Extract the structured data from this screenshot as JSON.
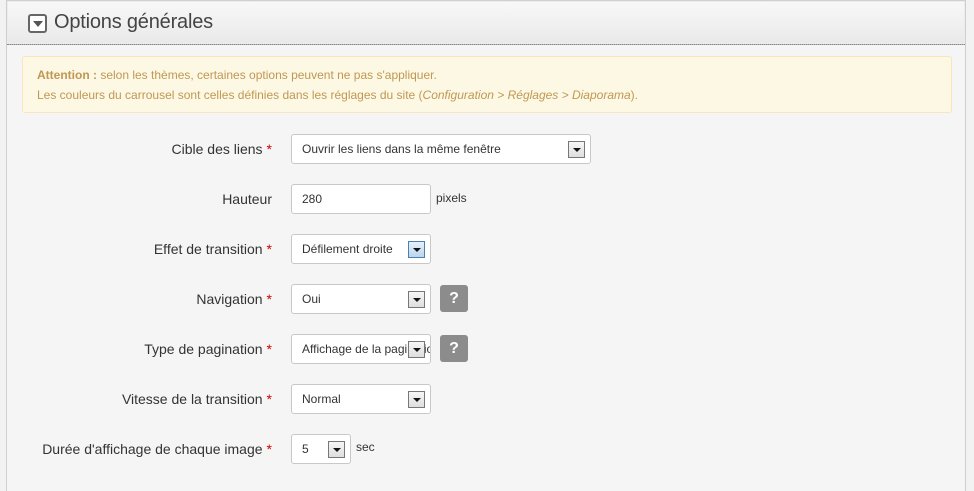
{
  "header": {
    "title": "Options générales",
    "toggle_icon": "collapse-arrow-icon"
  },
  "notice": {
    "label": "Attention :",
    "line1_text": " selon les thèmes, certaines options peuvent ne pas s'appliquer.",
    "line2_text": "Les couleurs du carrousel sont celles définies dans les réglages du site (",
    "line2_path": "Configuration > Réglages > Diaporama",
    "line2_end": ")."
  },
  "required_mark": "*",
  "fields": {
    "link_target": {
      "label": "Cible des liens",
      "value": "Ouvrir les liens dans la même fenêtre"
    },
    "height": {
      "label": "Hauteur",
      "value": "280",
      "unit": "pixels"
    },
    "transition_effect": {
      "label": "Effet de transition",
      "value": "Défilement droite"
    },
    "navigation": {
      "label": "Navigation",
      "value": "Oui",
      "help": "?"
    },
    "pagination_type": {
      "label": "Type de pagination",
      "value": "Affichage de la pagination",
      "help": "?"
    },
    "transition_speed": {
      "label": "Vitesse de la transition",
      "value": "Normal"
    },
    "display_duration": {
      "label": "Durée d'affichage de chaque image",
      "value": "5",
      "unit": "sec"
    }
  }
}
